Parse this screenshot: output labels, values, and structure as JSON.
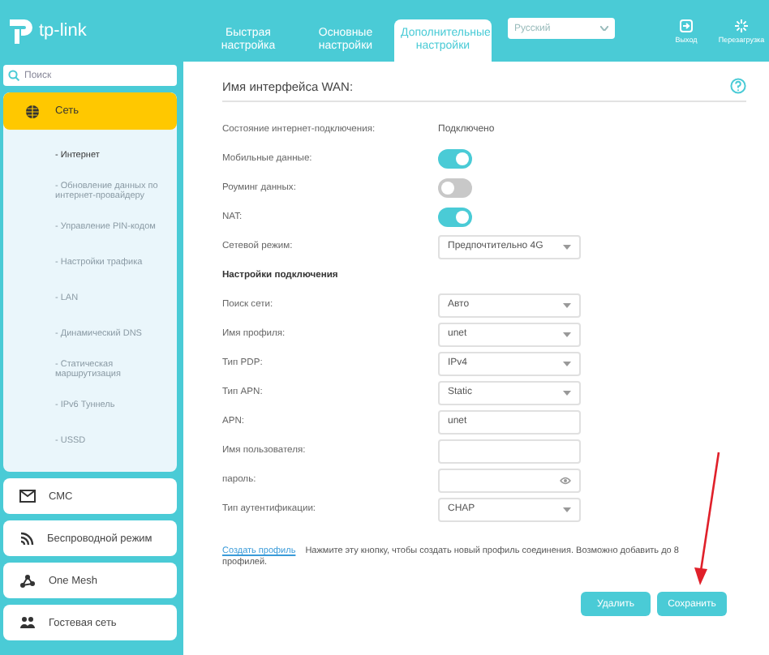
{
  "header": {
    "logo": "tp-link",
    "tabs": [
      {
        "label": "Быстрая настройка",
        "selected": false
      },
      {
        "label": "Основные настройки",
        "selected": false
      },
      {
        "label": "Дополнительные настройки",
        "selected": true
      }
    ],
    "language": "Русский",
    "actions": [
      {
        "label": "Выход"
      },
      {
        "label": "Перезагрузка"
      }
    ]
  },
  "sidebar": {
    "search_placeholder": "Поиск",
    "section": {
      "label": "Сеть",
      "expanded": true,
      "items": [
        {
          "label": "- Интернет",
          "selected": true
        },
        {
          "label": "- Обновление данных по интернет-провайдеру",
          "selected": false
        },
        {
          "label": "- Управление PIN-кодом",
          "selected": false
        },
        {
          "label": "- Настройки трафика",
          "selected": false
        },
        {
          "label": "- LAN",
          "selected": false
        },
        {
          "label": "- Динамический DNS",
          "selected": false
        },
        {
          "label": "- Статическая маршрутизация",
          "selected": false
        },
        {
          "label": "- IPv6 Туннель",
          "selected": false
        },
        {
          "label": "- USSD",
          "selected": false
        }
      ]
    },
    "items": [
      {
        "label": "СМС"
      },
      {
        "label": "Беспроводной режим"
      },
      {
        "label": "One Mesh"
      },
      {
        "label": "Гостевая сеть"
      }
    ]
  },
  "main": {
    "title": "Имя интерфейса WAN:",
    "rows": [
      {
        "kind": "text",
        "label": "Состояние интернет-подключения:",
        "value": "Подключено"
      },
      {
        "kind": "toggle",
        "label": "Мобильные данные:",
        "on": true
      },
      {
        "kind": "toggle",
        "label": "Роуминг данных:",
        "on": false
      },
      {
        "kind": "toggle",
        "label": "NAT:",
        "on": true
      },
      {
        "kind": "select",
        "label": "Сетевой режим:",
        "value": "Предпочтительно 4G"
      },
      {
        "kind": "heading",
        "label": "Настройки подключения"
      },
      {
        "kind": "select",
        "label": "Поиск сети:",
        "value": "Авто"
      },
      {
        "kind": "select",
        "label": "Имя профиля:",
        "value": "unet"
      },
      {
        "kind": "select",
        "label": "Тип PDP:",
        "value": "IPv4"
      },
      {
        "kind": "select",
        "label": "Тип APN:",
        "value": "Static"
      },
      {
        "kind": "input",
        "label": "APN:",
        "value": "unet"
      },
      {
        "kind": "input",
        "label": "Имя пользователя:"
      },
      {
        "kind": "password",
        "label": "пароль:"
      },
      {
        "kind": "select",
        "label": "Тип аутентификации:",
        "value": "CHAP"
      }
    ],
    "create_link": "Создать профиль",
    "create_note": "Нажмите эту кнопку, чтобы создать новый профиль соединения. Возможно добавить до 8 профилей.",
    "buttons": [
      "Удалить",
      "Сохранить"
    ]
  }
}
